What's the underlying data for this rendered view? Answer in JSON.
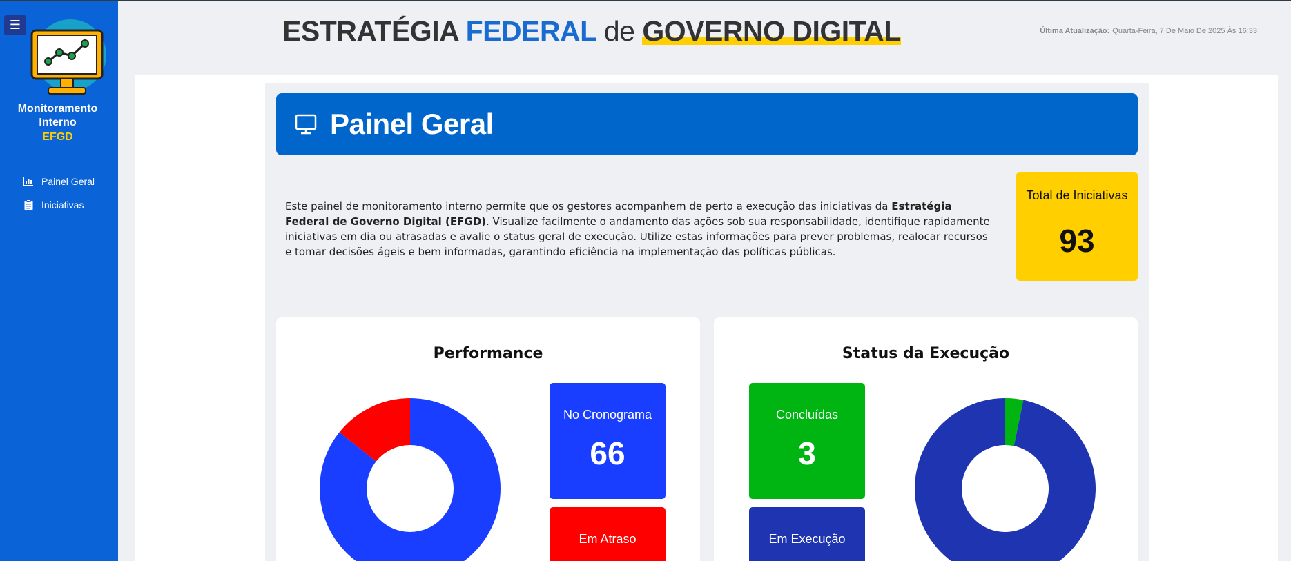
{
  "sidebar": {
    "menu_icon": "hamburger-icon",
    "logo_icon": "monitor-chart-icon",
    "brand_line1": "Monitoramento",
    "brand_line2": "Interno",
    "brand_line3": "EFGD",
    "items": [
      {
        "label": "Painel Geral",
        "icon": "bar-chart-icon"
      },
      {
        "label": "Iniciativas",
        "icon": "clipboard-icon"
      }
    ]
  },
  "header": {
    "title_part1": "ESTRATÉGIA",
    "title_part2": "FEDERAL",
    "title_part3": "de",
    "title_part4": "GOVERNO DIGITAL",
    "update_label": "Última Atualização:",
    "update_value": "Quarta-Feira, 7 De Maio De 2025 Às 16:33"
  },
  "banner": {
    "icon": "monitor-icon",
    "title": "Painel Geral"
  },
  "intro": {
    "text_before": "Este painel de monitoramento interno permite que os gestores acompanhem de perto a execução das iniciativas da ",
    "text_bold": "Estratégia Federal de Governo Digital (EFGD)",
    "text_after": ". Visualize facilmente o andamento das ações sob sua responsabilidade, identifique rapidamente iniciativas em dia ou atrasadas e avalie o status geral de execução. Utilize estas informações para prever problemas, realocar recursos e tomar decisões ágeis e bem informadas, garantindo eficiência na implementação das políticas públicas."
  },
  "total": {
    "label": "Total de Iniciativas",
    "value": "93"
  },
  "performance": {
    "title": "Performance",
    "stats": [
      {
        "label": "No Cronograma",
        "value": "66",
        "color": "#1a3eff"
      },
      {
        "label": "Em Atraso",
        "value": "",
        "color": "#ff0000"
      }
    ]
  },
  "status": {
    "title": "Status da Execução",
    "stats": [
      {
        "label": "Concluídas",
        "value": "3",
        "color": "#00b512"
      },
      {
        "label": "Em Execução",
        "value": "",
        "color": "#1e34b0"
      }
    ]
  },
  "chart_data": [
    {
      "type": "pie",
      "title": "Performance",
      "categories": [
        "No Cronograma",
        "Em Atraso"
      ],
      "values": [
        66,
        11
      ],
      "colors": [
        "#1a3eff",
        "#ff0000"
      ]
    },
    {
      "type": "pie",
      "title": "Status da Execução",
      "categories": [
        "Concluídas",
        "Em Execução"
      ],
      "values": [
        3,
        90
      ],
      "colors": [
        "#00b512",
        "#1e34b0"
      ]
    }
  ]
}
